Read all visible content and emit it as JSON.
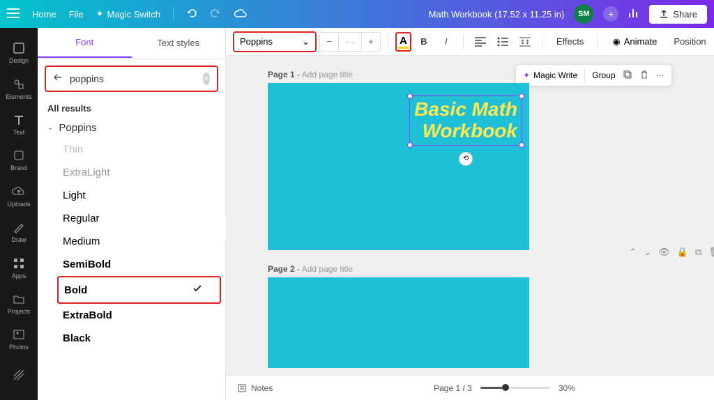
{
  "header": {
    "home": "Home",
    "file": "File",
    "magic_switch": "Magic Switch",
    "doc_title": "Math Workbook (17.52 x 11.25 in)",
    "avatar_initials": "SM",
    "share": "Share"
  },
  "rail": {
    "design": "Design",
    "elements": "Elements",
    "text": "Text",
    "brand": "Brand",
    "uploads": "Uploads",
    "draw": "Draw",
    "apps": "Apps",
    "projects": "Projects",
    "photos": "Photos"
  },
  "panel": {
    "tab_font": "Font",
    "tab_styles": "Text styles",
    "search_value": "poppins",
    "all_results": "All results",
    "font_family": "Poppins",
    "weights": {
      "thin": "Thin",
      "elight": "ExtraLight",
      "light": "Light",
      "regular": "Regular",
      "medium": "Medium",
      "semi": "SemiBold",
      "bold": "Bold",
      "ebold": "ExtraBold",
      "black": "Black"
    }
  },
  "toolbar": {
    "font_name": "Poppins",
    "size": "- -",
    "color_glyph": "A",
    "effects": "Effects",
    "animate": "Animate",
    "position": "Position"
  },
  "page_toolbar": {
    "magic_write": "Magic Write",
    "group": "Group"
  },
  "pages": {
    "p1_label": "Page 1",
    "p2_label": "Page 2",
    "title_placeholder": "Add page title",
    "text_line1": "Basic Math",
    "text_line2": "Workbook"
  },
  "bottom": {
    "notes": "Notes",
    "page_counter": "Page 1 / 3",
    "zoom": "30%"
  }
}
